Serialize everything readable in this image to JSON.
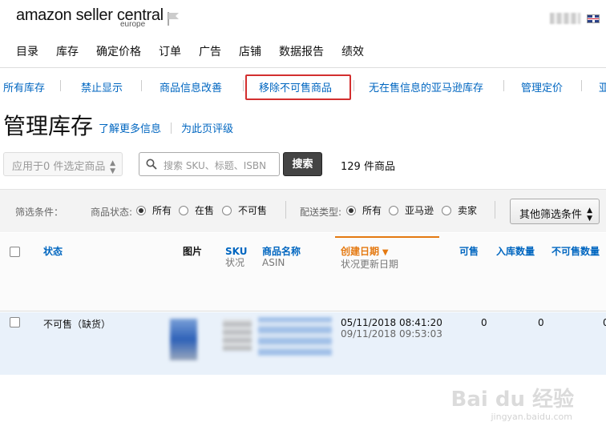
{
  "logo": {
    "main": "amazon seller central",
    "sub": "europe"
  },
  "main_nav": [
    "目录",
    "库存",
    "确定价格",
    "订单",
    "广告",
    "店铺",
    "数据报告",
    "绩效"
  ],
  "sub_nav": [
    "所有库存",
    "禁止显示",
    "商品信息改善",
    "移除不可售商品",
    "无在售信息的亚马逊库存",
    "管理定价",
    "亚"
  ],
  "page_title": "管理库存",
  "title_links": [
    "了解更多信息",
    "为此页评级"
  ],
  "toolbar": {
    "apply_select": "应用于0 件选定商品",
    "search_placeholder": "搜索 SKU、标题、ISBN",
    "search_button": "搜索",
    "count": "129 件商品"
  },
  "filters": {
    "label": "筛选条件：",
    "status_label": "商品状态:",
    "status_options": [
      "所有",
      "在售",
      "不可售"
    ],
    "status_selected": "所有",
    "fulfill_label": "配送类型:",
    "fulfill_options": [
      "所有",
      "亚马逊",
      "卖家"
    ],
    "fulfill_selected": "所有",
    "more_button": "其他筛选条件"
  },
  "table": {
    "headers": {
      "status": "状态",
      "image": "图片",
      "sku": "SKU",
      "sku_sub": "状况",
      "name": "商品名称",
      "name_sub": "ASIN",
      "created": "创建日期",
      "created_sub": "状况更新日期",
      "available": "可售",
      "inbound": "入库数量",
      "unfulfillable": "不可售数量"
    },
    "rows": [
      {
        "status": "不可售（缺货）",
        "created": "05/11/2018 08:41:20",
        "updated": "09/11/2018 09:53:03",
        "available": "0",
        "inbound": "0",
        "unfulfillable": "0"
      }
    ]
  },
  "watermark": {
    "main": "Bai du 经验",
    "sub": "jingyan.baidu.com"
  },
  "colors": {
    "link": "#0066c0",
    "highlight": "#d32f2f",
    "sort_active": "#e47911"
  }
}
